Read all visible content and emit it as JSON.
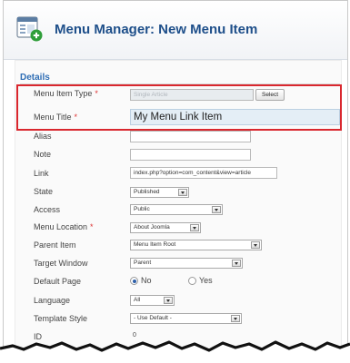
{
  "header": {
    "title": "Menu Manager: New Menu Item",
    "icon": "menu-manager-icon"
  },
  "details": {
    "section_title": "Details",
    "menu_item_type": {
      "label": "Menu Item Type",
      "required_mark": "*",
      "value": "Single Article",
      "button": "Select"
    },
    "menu_title": {
      "label": "Menu Title",
      "required_mark": "*",
      "value": "My Menu Link Item"
    },
    "alias": {
      "label": "Alias",
      "value": ""
    },
    "note": {
      "label": "Note",
      "value": ""
    },
    "link": {
      "label": "Link",
      "value": "index.php?option=com_content&view=article"
    },
    "state": {
      "label": "State",
      "value": "Published"
    },
    "access": {
      "label": "Access",
      "value": "Public"
    },
    "menu_location": {
      "label": "Menu Location",
      "required_mark": "*",
      "value": "About Joomla"
    },
    "parent_item": {
      "label": "Parent Item",
      "value": "Menu Item Root"
    },
    "target_window": {
      "label": "Target Window",
      "value": "Parent"
    },
    "default_page": {
      "label": "Default Page",
      "options": [
        "No",
        "Yes"
      ],
      "selected": "No"
    },
    "language": {
      "label": "Language",
      "value": "All"
    },
    "template_style": {
      "label": "Template Style",
      "value": "- Use Default -"
    },
    "id": {
      "label": "ID",
      "value": "0"
    }
  },
  "colors": {
    "title": "#1e4f8a",
    "section": "#2e6db4",
    "highlight": "#d9272e",
    "required": "#d33333"
  }
}
